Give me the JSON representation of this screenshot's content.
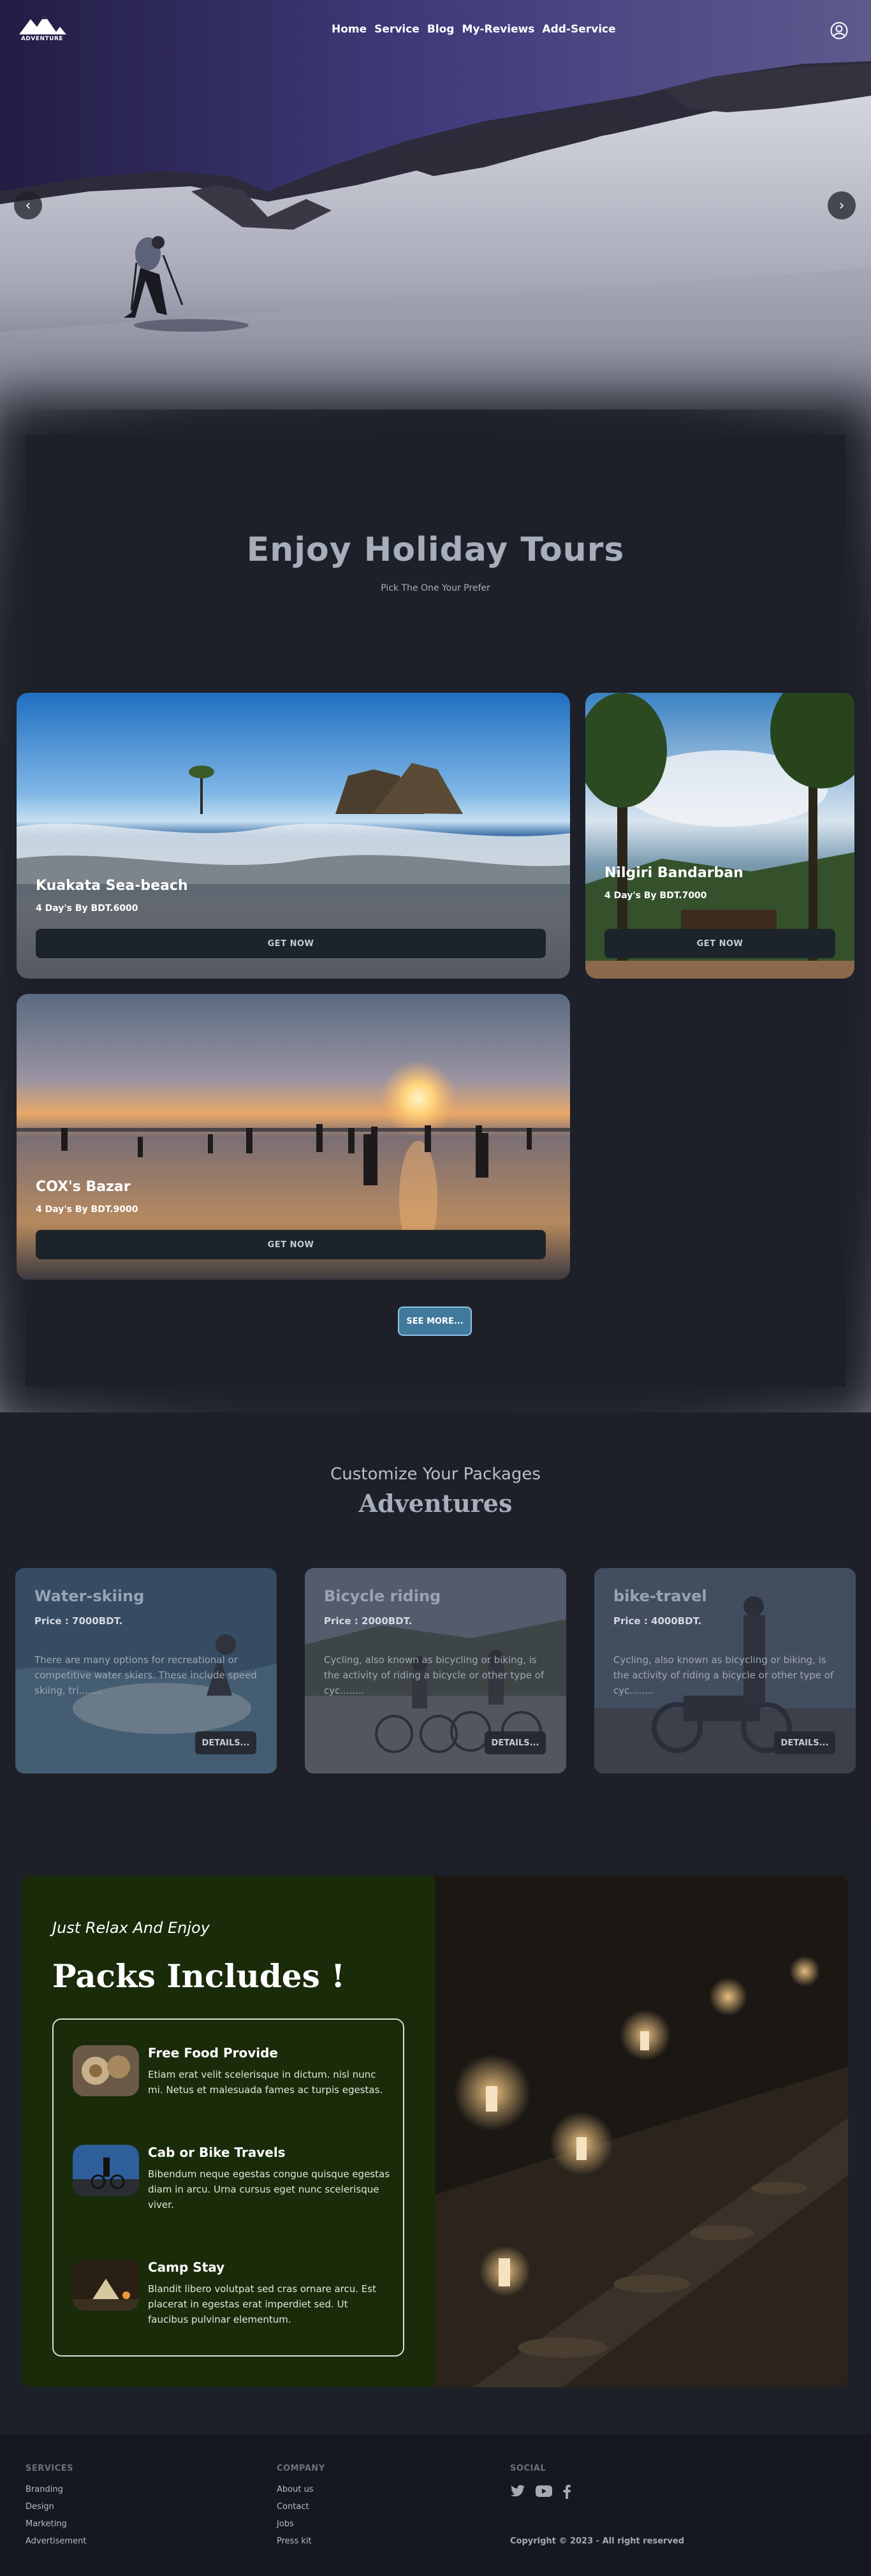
{
  "nav": {
    "logo_text": "ADVENTURE",
    "links": [
      "Home",
      "Service",
      "Blog",
      "My-Reviews",
      "Add-Service"
    ],
    "prev": "‹",
    "next": "›"
  },
  "tours": {
    "title": "Enjoy Holiday Tours",
    "subtitle": "Pick The One Your Prefer",
    "cards": [
      {
        "name": "Kuakata Sea-beach",
        "price": "4 Day's By BDT.6000",
        "button": "GET NOW"
      },
      {
        "name": "Nilgiri Bandarban",
        "price": "4 Day's By BDT.7000",
        "button": "GET NOW"
      },
      {
        "name": "COX's Bazar",
        "price": "4 Day's By BDT.9000",
        "button": "GET NOW"
      }
    ],
    "see_more": "SEE MORE..."
  },
  "adventures": {
    "kicker": "Customize Your Packages",
    "title": "Adventures",
    "cards": [
      {
        "name": "Water-skiing",
        "price": "Price : 7000BDT.",
        "desc": "There are many options for recreational or competitive water skiers. These include speed skiing, tri........",
        "button": "DETAILS..."
      },
      {
        "name": "Bicycle riding",
        "price": "Price : 2000BDT.",
        "desc": "Cycling, also known as bicycling or biking, is the activity of riding a bicycle or other type of cyc........",
        "button": "DETAILS..."
      },
      {
        "name": "bike-travel",
        "price": "Price : 4000BDT.",
        "desc": "Cycling, also known as bicycling or biking, is the activity of riding a bicycle or other type of cyc........",
        "button": "DETAILS..."
      }
    ]
  },
  "packs": {
    "kicker": "Just Relax And Enjoy",
    "title": "Packs Includes !",
    "items": [
      {
        "name": "Free Food Provide",
        "desc": "Etiam erat velit scelerisque in dictum. nisl nunc mi. Netus et malesuada fames ac turpis egestas."
      },
      {
        "name": "Cab or Bike Travels",
        "desc": "Bibendum neque egestas congue quisque egestas diam in arcu. Urna cursus eget nunc scelerisque viver."
      },
      {
        "name": "Camp Stay",
        "desc": "Blandit libero volutpat sed cras ornare arcu. Est placerat in egestas erat imperdiet sed. Ut faucibus pulvinar elementum."
      }
    ]
  },
  "footer": {
    "services_head": "SERVICES",
    "services": [
      "Branding",
      "Design",
      "Marketing",
      "Advertisement"
    ],
    "company_head": "COMPANY",
    "company": [
      "About us",
      "Contact",
      "Jobs",
      "Press kit"
    ],
    "social_head": "SOCIAL",
    "copyright": "Copyright © 2023 - All right reserved"
  },
  "colors": {
    "hero_sky": "#3d3a78",
    "section_bg": "#1d2028",
    "see_more": "#41799d",
    "packs_green": "#1a2b0a"
  }
}
